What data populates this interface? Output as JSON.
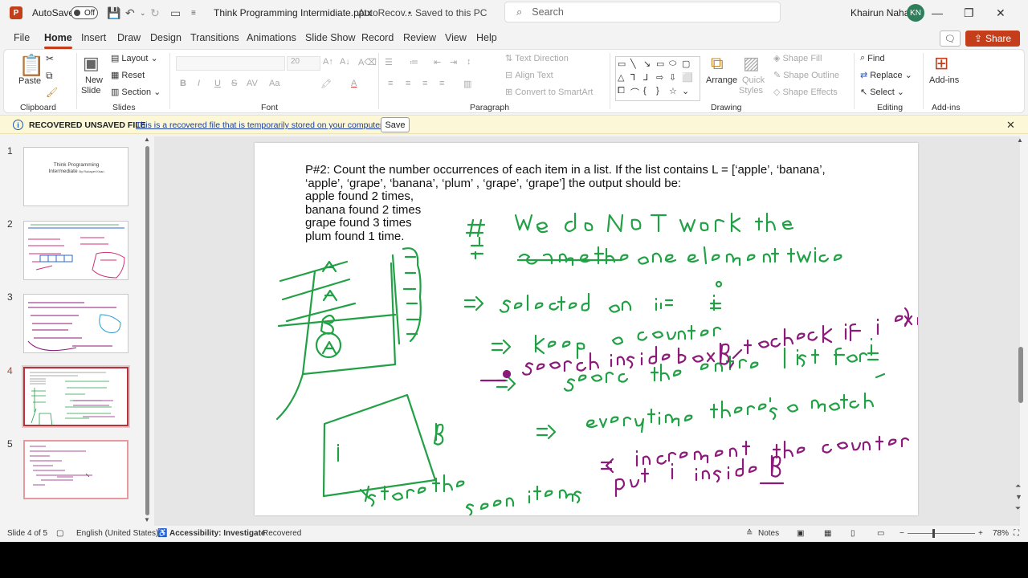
{
  "titlebar": {
    "app_logo": "P",
    "autosave_label": "AutoSave",
    "autosave_state": "Off",
    "doc_title": "Think Programming Intermidiate.pptx",
    "doc_location_1": "AutoRecov...",
    "doc_location_2": "Saved to this PC",
    "search_placeholder": "Search",
    "user_name": "Khairun Nahar",
    "user_initials": "KN"
  },
  "menu": {
    "tabs": [
      "File",
      "Home",
      "Insert",
      "Draw",
      "Design",
      "Transitions",
      "Animations",
      "Slide Show",
      "Record",
      "Review",
      "View",
      "Help"
    ],
    "active": "Home",
    "share_label": "Share"
  },
  "ribbon": {
    "clipboard": {
      "paste": "Paste",
      "group": "Clipboard"
    },
    "slides": {
      "new_slide_1": "New",
      "new_slide_2": "Slide",
      "layout": "Layout",
      "reset": "Reset",
      "section": "Section",
      "group": "Slides"
    },
    "font": {
      "size": "20",
      "bold": "B",
      "italic": "I",
      "underline": "U",
      "strike": "S",
      "spacing": "AV",
      "group": "Font"
    },
    "paragraph": {
      "text_direction": "Text Direction",
      "align_text": "Align Text",
      "smartart": "Convert to SmartArt",
      "group": "Paragraph"
    },
    "drawing": {
      "arrange": "Arrange",
      "quick_styles_1": "Quick",
      "quick_styles_2": "Styles",
      "shape_fill": "Shape Fill",
      "shape_outline": "Shape Outline",
      "shape_effects": "Shape Effects",
      "group": "Drawing"
    },
    "editing": {
      "find": "Find",
      "replace": "Replace",
      "select": "Select",
      "group": "Editing"
    },
    "addins": {
      "label": "Add-ins",
      "group": "Add-ins"
    }
  },
  "infobar": {
    "title": "RECOVERED UNSAVED FILE",
    "message": "This is a recovered file that is temporarily stored on your computer.",
    "save_label": "Save"
  },
  "thumbnails": {
    "numbers": [
      "1",
      "2",
      "3",
      "4",
      "5"
    ],
    "slide1_title_1": "Think Programming",
    "slide1_title_2": "Intermediate",
    "slide1_author": "By Rubayet Khan"
  },
  "slide": {
    "problem_lines": [
      "P#2: Count the number occurrences of each item in a list. If the list contains L = [‘apple’, ‘banana’,",
      "‘apple’, ‘grape’, ‘banana’, ‘plum’ , ‘grape’, ‘grape’] the output should be:",
      "apple found 2 times,",
      "banana found 2 times",
      "grape found 3 times",
      "plum found 1 time."
    ],
    "ink_green": "#22a045",
    "ink_purple": "#8b1a7a"
  },
  "statusbar": {
    "slide_pos": "Slide 4 of 5",
    "language": "English (United States)",
    "accessibility": "Accessibility: Investigate",
    "recovered": "Recovered",
    "notes": "Notes",
    "zoom": "78%"
  }
}
